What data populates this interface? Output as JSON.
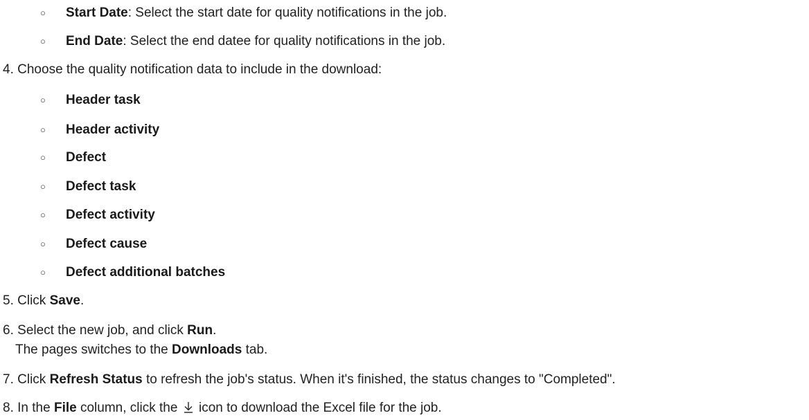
{
  "steps": {
    "step3_subitems": [
      {
        "bold": "Start Date",
        "rest": ": Select the start date for quality notifications in the job."
      },
      {
        "bold": "End Date",
        "rest": ": Select the end datee for quality notifications in the job."
      }
    ],
    "step4": {
      "number": "4.",
      "text": "Choose the quality notification data to include in the download:",
      "options": [
        "Header task",
        "Header activity",
        "Defect",
        "Defect task",
        "Defect activity",
        "Defect cause",
        "Defect additional batches"
      ]
    },
    "step5": {
      "number": "5.",
      "pre": "Click ",
      "bold": "Save",
      "post": "."
    },
    "step6": {
      "number": "6.",
      "pre": "Select the new job, and click ",
      "bold": "Run",
      "post": ".",
      "line2_pre": "The pages switches to the ",
      "line2_bold": "Downloads",
      "line2_post": " tab."
    },
    "step7": {
      "number": "7.",
      "pre": "Click ",
      "bold": "Refresh Status",
      "post": " to refresh the job's status. When it's finished, the status changes to \"Completed\"."
    },
    "step8": {
      "number": "8.",
      "pre": "In the ",
      "bold": "File",
      "mid": " column, click the ",
      "icon": "download-icon",
      "post": " icon to download the Excel file for the job."
    }
  }
}
